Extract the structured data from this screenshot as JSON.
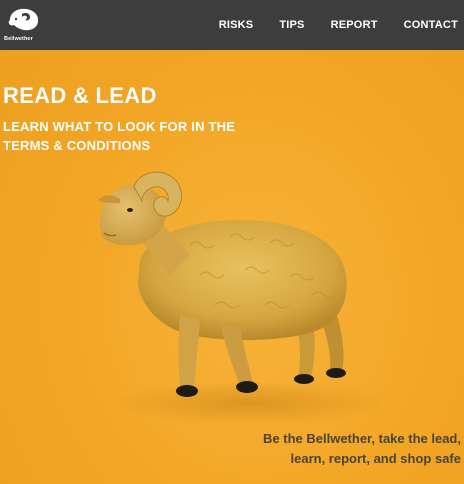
{
  "header": {
    "logo_text": "Bellwether",
    "logo_icon": "ram-head-icon",
    "nav": [
      {
        "label": "RISKS"
      },
      {
        "label": "TIPS"
      },
      {
        "label": "REPORT"
      },
      {
        "label": "CONTACT"
      }
    ]
  },
  "hero": {
    "title": "READ & LEAD",
    "subtitle": "LEARN WHAT TO LOOK FOR IN THE TERMS & CONDITIONS",
    "image": "ram-figurine",
    "tagline_line1": "Be the Bellwether, take the lead,",
    "tagline_line2": "learn, report, and shop safe"
  },
  "colors": {
    "background": "#f2a524",
    "header_bg": "#3d3d3d",
    "header_text": "#ffffff",
    "hero_text": "#ffffff",
    "tagline_text": "#4a4338"
  }
}
